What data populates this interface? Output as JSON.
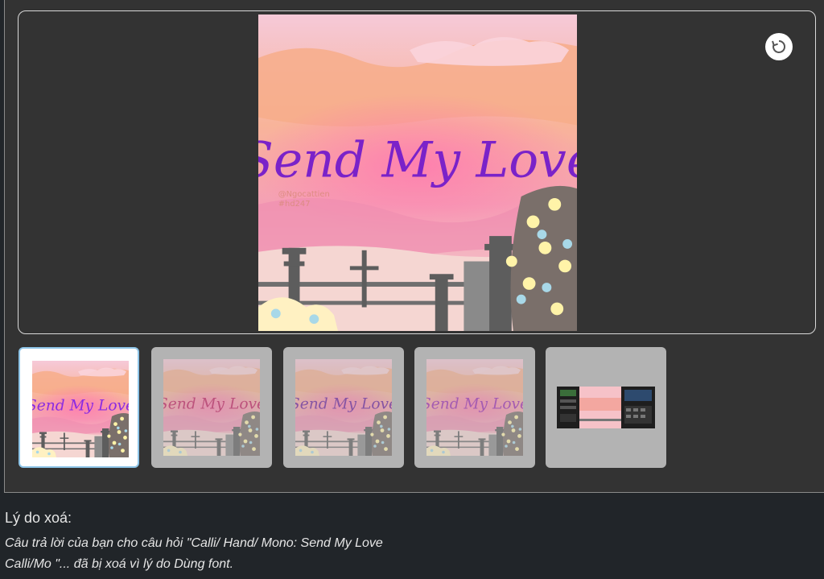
{
  "viewer": {
    "main_image": {
      "title_text": "Send My Love",
      "watermark_line1": "@Ngocattien",
      "watermark_line2": "#hd247"
    },
    "rotate_icon": "rotate-icon"
  },
  "thumbnails": [
    {
      "title_text": "Send My Love",
      "title_color": "#8a2be2",
      "active": true
    },
    {
      "title_text": "Send My Love",
      "title_color": "#c2185b",
      "active": false
    },
    {
      "title_text": "Send My Love",
      "title_color": "#6a1b9a",
      "active": false
    },
    {
      "title_text": "Send My Love",
      "title_color": "#9c27b0",
      "active": false
    },
    {
      "kind": "video-preview",
      "active": false
    }
  ],
  "deletion": {
    "title": "Lý do xoá:",
    "line1": "Câu trả lời của bạn cho câu hỏi \"Calli/ Hand/ Mono: Send My Love",
    "line2": "Calli/Mo \"... đã bị xoá vì lý do Dùng font."
  },
  "colors": {
    "page_bg": "#212529",
    "panel_bg": "#333333",
    "active_border": "#8ec5e8"
  }
}
